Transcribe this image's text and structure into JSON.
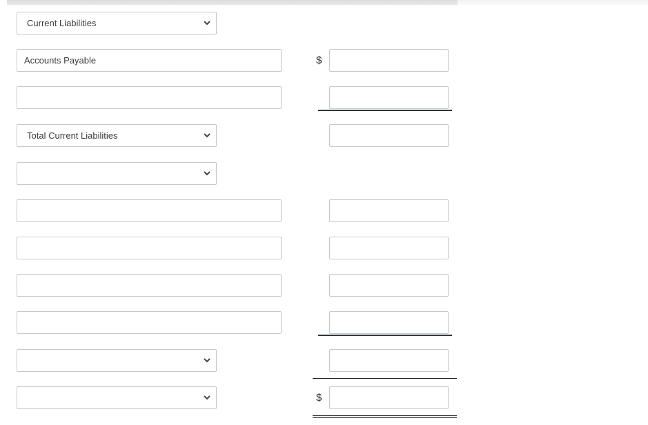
{
  "form": {
    "rows": [
      {
        "type": "select",
        "label_value": "Current Liabilities"
      },
      {
        "type": "text",
        "label_value": "Accounts Payable",
        "currency": "$",
        "amount": ""
      },
      {
        "type": "text",
        "label_value": "",
        "amount": ""
      },
      {
        "type": "select",
        "label_value": "Total Current Liabilities",
        "amount": ""
      },
      {
        "type": "select",
        "label_value": ""
      },
      {
        "type": "text",
        "label_value": "",
        "amount": ""
      },
      {
        "type": "text",
        "label_value": "",
        "amount": ""
      },
      {
        "type": "text",
        "label_value": "",
        "amount": ""
      },
      {
        "type": "text",
        "label_value": "",
        "amount": ""
      },
      {
        "type": "select",
        "label_value": "",
        "amount": ""
      },
      {
        "type": "select",
        "label_value": "",
        "currency": "$",
        "amount": ""
      }
    ]
  },
  "icons": {
    "dropdown": "chevron-down-icon"
  }
}
